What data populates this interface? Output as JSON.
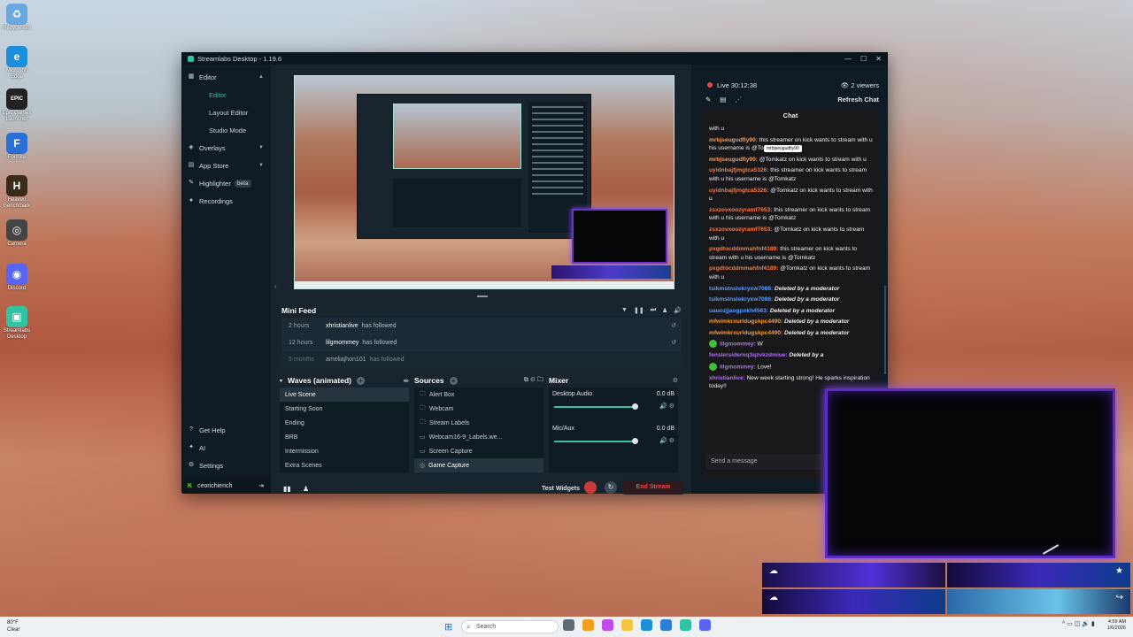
{
  "desktop": {
    "icons": [
      {
        "label": "Recycle Bin",
        "icon": "recycle-bin-icon",
        "color": "#6aa9e0",
        "glyph": "♻"
      },
      {
        "label": "Microsoft Edge",
        "icon": "edge-icon",
        "color": "#1d8fd8",
        "glyph": "e"
      },
      {
        "label": "Epic Games Launcher",
        "icon": "epic-games-icon",
        "color": "#222222",
        "glyph": "EPIC"
      },
      {
        "label": "Fortnite",
        "icon": "fortnite-icon",
        "color": "#2a6fd6",
        "glyph": "F"
      },
      {
        "label": "Heaven Benchmark",
        "icon": "heaven-icon",
        "color": "#3a2a18",
        "glyph": "H"
      },
      {
        "label": "Camera",
        "icon": "camera-app-icon",
        "color": "#444444",
        "glyph": "◎"
      },
      {
        "label": "Discord",
        "icon": "discord-icon",
        "color": "#5865f2",
        "glyph": "◉"
      },
      {
        "label": "Streamlabs Desktop",
        "icon": "streamlabs-icon",
        "color": "#31c3a2",
        "glyph": "▣"
      }
    ]
  },
  "window": {
    "title": "Streamlabs Desktop - 1.19.6",
    "controls": [
      "—",
      "☐",
      "✕"
    ]
  },
  "sidebar": {
    "items": [
      {
        "label": "Editor",
        "icon": "editor-icon",
        "glyph": "▦",
        "chev": "▲"
      },
      {
        "label": "Overlays",
        "icon": "overlays-icon",
        "glyph": "◈",
        "chev": "▼"
      },
      {
        "label": "App Store",
        "icon": "app-store-icon",
        "glyph": "▤",
        "chev": "▼"
      },
      {
        "label": "Highlighter",
        "icon": "highlighter-icon",
        "glyph": "✎",
        "badge": "beta"
      },
      {
        "label": "Recordings",
        "icon": "recordings-icon",
        "glyph": "●"
      }
    ],
    "sub_items": [
      "Editor",
      "Layout Editor",
      "Studio Mode"
    ],
    "bottom": [
      {
        "label": "Get Help",
        "icon": "help-icon",
        "glyph": "?"
      },
      {
        "label": "AI",
        "icon": "ai-icon",
        "glyph": "✦"
      },
      {
        "label": "Settings",
        "icon": "settings-icon",
        "glyph": "⚙"
      }
    ],
    "user": "ceorichierich",
    "user_icon_glyph": "K",
    "logout_glyph": "⇥"
  },
  "minifeed": {
    "title": "Mini Feed",
    "tools": [
      "▼",
      "❚❚",
      "⏭",
      "♟",
      "🔊"
    ],
    "rows": [
      {
        "time": "2 hours",
        "name": "xhristianlive",
        "action": "has followed"
      },
      {
        "time": "12 hours",
        "name": "lilgmommey",
        "action": "has followed"
      },
      {
        "time": "5 months",
        "name": "ameliajhon101",
        "action": "has followed"
      }
    ],
    "replay_glyph": "↺"
  },
  "scenes": {
    "title": "Waves (animated)",
    "items": [
      "Live Scene",
      "Starting Soon",
      "Ending",
      "BRB",
      "Intermission",
      "Extra Scenes"
    ]
  },
  "sources": {
    "title": "Sources",
    "items": [
      {
        "label": "Alert Box",
        "glyph": "🗀"
      },
      {
        "label": "Webcam",
        "glyph": "🗀"
      },
      {
        "label": "Stream Labels",
        "glyph": "🗀"
      },
      {
        "label": "Webcam16-9_Labels.we...",
        "glyph": "▭"
      },
      {
        "label": "Screen Capture",
        "glyph": "▭"
      },
      {
        "label": "Game Capture",
        "glyph": "◎"
      }
    ]
  },
  "mixer": {
    "title": "Mixer",
    "channels": [
      {
        "name": "Desktop Audio",
        "db": "0.0 dB"
      },
      {
        "name": "Mic/Aux",
        "db": "0.0 dB"
      }
    ]
  },
  "bottombar": {
    "test_widgets": "Test Widgets",
    "end_stream": "End Stream"
  },
  "live": {
    "status": "Live 30:12:38",
    "viewers": "2 viewers",
    "refresh": "Refresh Chat"
  },
  "chat": {
    "title": "Chat",
    "tooltip": "mrbjseugudfiy90",
    "messages": [
      {
        "user": "",
        "color": "#efeff1",
        "text": "with u"
      },
      {
        "user": "mrbjseugudfiy90:",
        "color": "#ff9b4a",
        "text": " this streamer on kick wants to stream with u his username is @Tomkatz"
      },
      {
        "user": "mrbjseugudfiy90:",
        "color": "#ff9b4a",
        "text": " @Tomkatz on kick wants to stream with u"
      },
      {
        "user": "uyidnbajfjmgtca5326:",
        "color": "#ff7a3a",
        "text": " this streamer on kick wants to stream with u his username is @Tomkatz"
      },
      {
        "user": "uyidnbajfjmgtca5326:",
        "color": "#ff7a3a",
        "text": " @Tomkatz on kick wants to stream with u"
      },
      {
        "user": "zsxzovxoozyramf7653:",
        "color": "#ff7a3a",
        "text": " this streamer on kick wants to stream with u his username is @Tomkatz"
      },
      {
        "user": "zsxzovxoozyramf7653:",
        "color": "#ff7a3a",
        "text": " @Tomkatz on kick wants to stream with u"
      },
      {
        "user": "pxgdtocddmmahfnf4189:",
        "color": "#ff7a3a",
        "text": " this streamer on kick wants to stream with u his username is @Tomkatz"
      },
      {
        "user": "pxgdtocddmmahfnf4189:",
        "color": "#ff7a3a",
        "text": " @Tomkatz on kick wants to stream with u"
      },
      {
        "user": "tsikmstnslokryxw7086:",
        "color": "#5c9dff",
        "text": " Deleted by a moderator",
        "deleted": true
      },
      {
        "user": "tsikmstnslokryxw7086:",
        "color": "#5c9dff",
        "text": " Deleted by a moderator",
        "deleted": true
      },
      {
        "user": "uauozjjaogpnkh4563:",
        "color": "#5c9dff",
        "text": " Deleted by a moderator",
        "deleted": true
      },
      {
        "user": "mfwimkrxurldugskpc4490:",
        "color": "#ff9b2a",
        "text": " Deleted by a moderator",
        "deleted": true
      },
      {
        "user": "mfwimkrxurldugskpc4490:",
        "color": "#ff9b2a",
        "text": " Deleted by a moderator",
        "deleted": true
      },
      {
        "user": "lilgmommey:",
        "color": "#b26bff",
        "text": " W",
        "emote": true
      },
      {
        "user": "fenslersidernq3qzvkzdmiue:",
        "color": "#b26bff",
        "text": " Deleted by a",
        "deleted": true
      },
      {
        "user": "lilgmommey:",
        "color": "#b26bff",
        "text": " Love!",
        "emote": true
      },
      {
        "user": "xhristianlive:",
        "color": "#b26bff",
        "text": " New week starting strong! He sparks inspiration today!!"
      }
    ],
    "send_placeholder": "Send a message"
  },
  "taskbar": {
    "weather_temp": "80°F",
    "weather_desc": "Clear",
    "search": "Search",
    "time": "4:59 AM",
    "date": "1/6/2026",
    "apps": [
      "#5b6b77",
      "#f0a020",
      "#c04be8",
      "#f5c542",
      "#1d8fd8",
      "#2a7fd4",
      "#31c3a2",
      "#5865f2"
    ]
  }
}
